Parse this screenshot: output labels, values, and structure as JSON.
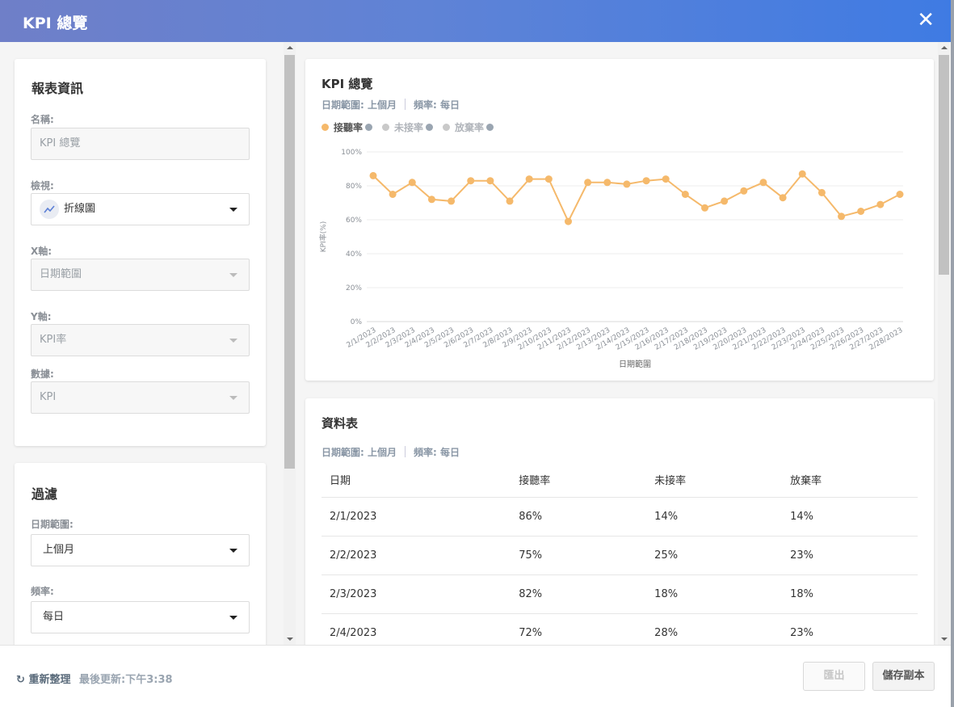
{
  "header": {
    "title": "KPI 總覽",
    "close_icon": "close-icon"
  },
  "report_info": {
    "heading": "報表資訊",
    "name_label": "名稱:",
    "name_value": "KPI 總覽",
    "view_label": "檢視:",
    "view_value": "折線圖",
    "x_label": "X軸:",
    "x_value": "日期範圍",
    "y_label": "Y軸:",
    "y_value": "KPI率",
    "data_label": "數據:",
    "data_value": "KPI"
  },
  "filters": {
    "heading": "過濾",
    "date_range_label": "日期範圍:",
    "date_range_value": "上個月",
    "frequency_label": "頻率:",
    "frequency_value": "每日"
  },
  "chart_card": {
    "title": "KPI 總覽",
    "date_range": "日期範圍: 上個月",
    "frequency": "頻率: 每日",
    "legend": [
      {
        "name": "接聽率",
        "color": "#f5b96b",
        "active": true
      },
      {
        "name": "未接率",
        "color": "#c9c9c9",
        "active": false
      },
      {
        "name": "放棄率",
        "color": "#c9c9c9",
        "active": false
      }
    ]
  },
  "chart_data": {
    "type": "line",
    "title": "",
    "xlabel": "日期範圍",
    "ylabel": "KPI率(%)",
    "ylim": [
      0,
      100
    ],
    "yticks": [
      "0%",
      "20%",
      "40%",
      "60%",
      "80%",
      "100%"
    ],
    "grid": true,
    "categories": [
      "2/1/2023",
      "2/2/2023",
      "2/3/2023",
      "2/4/2023",
      "2/5/2023",
      "2/6/2023",
      "2/7/2023",
      "2/8/2023",
      "2/9/2023",
      "2/10/2023",
      "2/11/2023",
      "2/12/2023",
      "2/13/2023",
      "2/14/2023",
      "2/15/2023",
      "2/16/2023",
      "2/17/2023",
      "2/18/2023",
      "2/19/2023",
      "2/20/2023",
      "2/21/2023",
      "2/22/2023",
      "2/23/2023",
      "2/24/2023",
      "2/25/2023",
      "2/26/2023",
      "2/27/2023",
      "2/28/2023"
    ],
    "series": [
      {
        "name": "接聽率",
        "color": "#f5b96b",
        "values": [
          86,
          75,
          82,
          72,
          71,
          83,
          83,
          71,
          84,
          84,
          59,
          82,
          82,
          81,
          83,
          84,
          75,
          67,
          71,
          77,
          82,
          73,
          87,
          76,
          62,
          65,
          69,
          75
        ]
      }
    ]
  },
  "table_card": {
    "title": "資料表",
    "date_range": "日期範圍: 上個月",
    "frequency": "頻率: 每日",
    "columns": [
      "日期",
      "接聽率",
      "未接率",
      "放棄率"
    ],
    "rows": [
      [
        "2/1/2023",
        "86%",
        "14%",
        "14%"
      ],
      [
        "2/2/2023",
        "75%",
        "25%",
        "23%"
      ],
      [
        "2/3/2023",
        "82%",
        "18%",
        "18%"
      ],
      [
        "2/4/2023",
        "72%",
        "28%",
        "23%"
      ]
    ]
  },
  "footer": {
    "refresh_label": "重新整理",
    "last_updated": "最後更新:下午3:38",
    "export_label": "匯出",
    "save_copy_label": "儲存副本"
  }
}
